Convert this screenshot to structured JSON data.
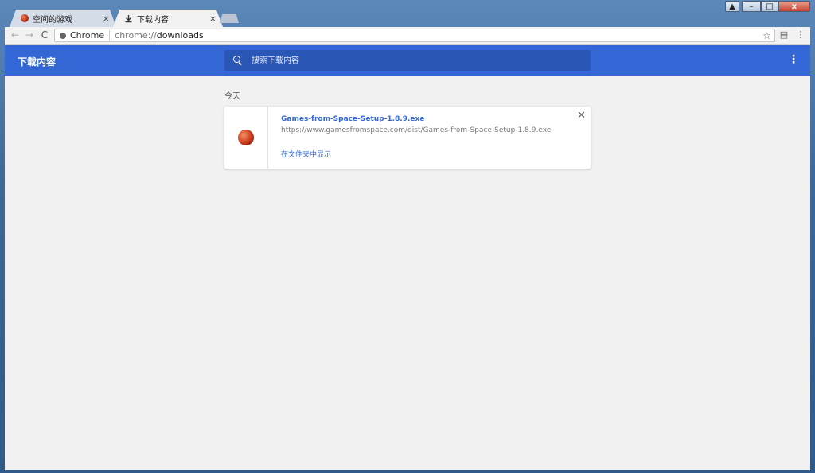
{
  "window": {
    "minimize_glyph": "–",
    "maximize_glyph": "□",
    "close_glyph": "x",
    "user_glyph": "▲"
  },
  "tabs": [
    {
      "label": "空间的游戏",
      "close": "×",
      "icon": "game-ball-icon"
    },
    {
      "label": "下载内容",
      "close": "×",
      "icon": "download-icon"
    }
  ],
  "toolbar": {
    "back": "←",
    "forward": "→",
    "reload": "C",
    "origin_label": "Chrome",
    "url_prefix": "chrome://",
    "url_path": "downloads",
    "star": "☆",
    "cast_glyph": "▤",
    "menu_glyph": "⋮"
  },
  "downloads": {
    "title": "下载内容",
    "search_placeholder": "搜索下载内容",
    "more_glyph": "⋮",
    "section_date": "今天",
    "items": [
      {
        "file_name": "Games-from-Space-Setup-1.8.9.exe",
        "url": "https://www.gamesfromspace.com/dist/Games-from-Space-Setup-1.8.9.exe",
        "show_in_folder": "在文件夹中显示",
        "remove_glyph": "✕"
      }
    ]
  },
  "colors": {
    "accent": "#3367d6",
    "search_bg": "#2a56b5",
    "content_bg": "#f1f1f1"
  }
}
